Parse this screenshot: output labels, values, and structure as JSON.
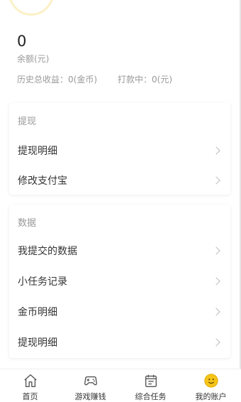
{
  "balance": {
    "value": "0",
    "label": "余额(元)"
  },
  "stats": {
    "total_income": "历史总收益：0(金币)",
    "paying": "打款中：0(元)"
  },
  "sections": {
    "withdraw": {
      "title": "提现",
      "items": [
        {
          "label": "提现明细"
        },
        {
          "label": "修改支付宝"
        }
      ]
    },
    "data": {
      "title": "数据",
      "items": [
        {
          "label": "我提交的数据"
        },
        {
          "label": "小任务记录"
        },
        {
          "label": "金币明细"
        },
        {
          "label": "提现明细"
        }
      ]
    }
  },
  "tabbar": {
    "active": "我的账户",
    "accent_color": "#f5c518",
    "items": [
      {
        "label": "首页",
        "icon": "home-icon"
      },
      {
        "label": "游戏赚钱",
        "icon": "gamepad-icon"
      },
      {
        "label": "综合任务",
        "icon": "calendar-icon"
      },
      {
        "label": "我的账户",
        "icon": "smiley-face-icon"
      }
    ]
  }
}
